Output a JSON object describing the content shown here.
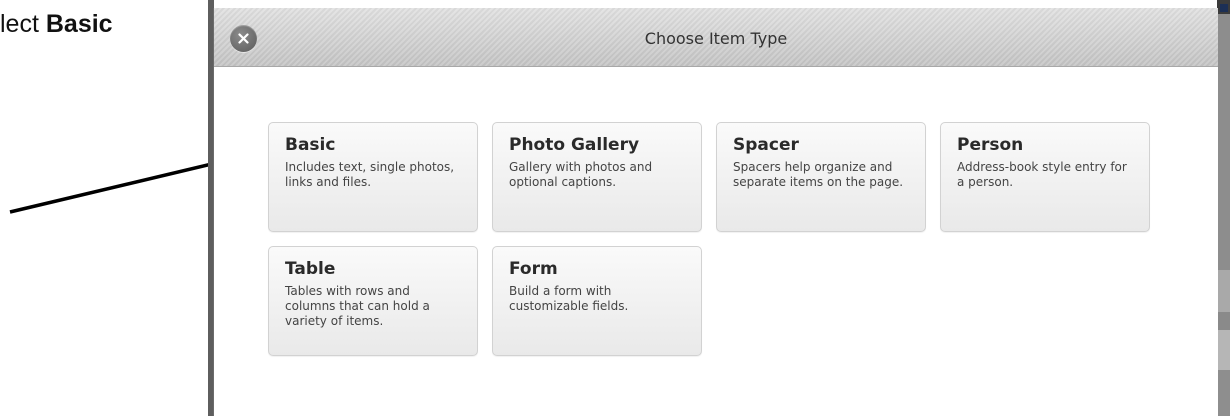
{
  "instruction": {
    "prefix": "lect ",
    "emphasis": "Basic"
  },
  "dialog": {
    "title": "Choose Item Type",
    "close_icon": "close-icon"
  },
  "item_types": [
    {
      "title": "Basic",
      "description": "Includes text, single photos, links and files."
    },
    {
      "title": "Photo Gallery",
      "description": "Gallery with photos and optional captions."
    },
    {
      "title": "Spacer",
      "description": "Spacers help organize and separate items on the page."
    },
    {
      "title": "Person",
      "description": "Address-book style entry for a person."
    },
    {
      "title": "Table",
      "description": "Tables with rows and columns that can hold a variety of items."
    },
    {
      "title": "Form",
      "description": "Build a form with customizable fields."
    }
  ],
  "colors": {
    "titlebar": "#cfcfcf",
    "tile_background": "#f2f2f2",
    "arrow": "#000000"
  }
}
